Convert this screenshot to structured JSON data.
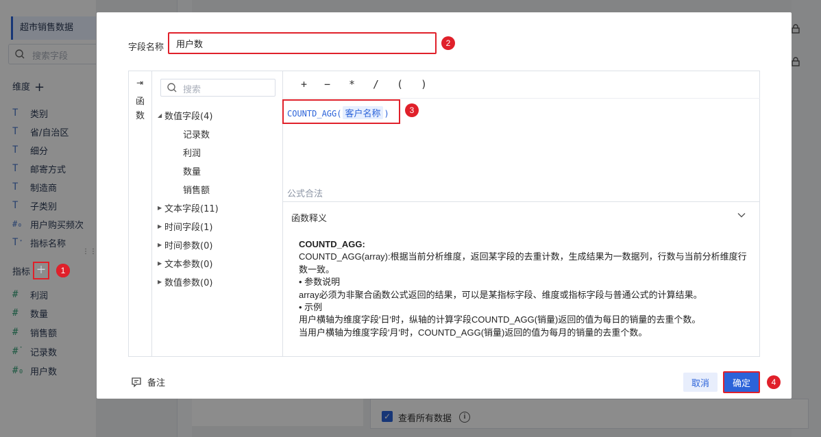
{
  "sidebar": {
    "dataset": "超市销售数据",
    "search_placeholder": "搜索字段",
    "dimension_header": "维度",
    "dimensions": [
      {
        "icon": "text-field-icon",
        "label": "类别"
      },
      {
        "icon": "text-field-icon",
        "label": "省/自治区"
      },
      {
        "icon": "text-field-icon",
        "label": "细分"
      },
      {
        "icon": "text-field-icon",
        "label": "邮寄方式"
      },
      {
        "icon": "text-field-icon",
        "label": "制造商"
      },
      {
        "icon": "text-field-icon",
        "label": "子类别"
      },
      {
        "icon": "numeric-dimension-icon",
        "label": "用户购买频次"
      },
      {
        "icon": "text-field-icon",
        "label": "指标名称"
      }
    ],
    "measure_header": "指标",
    "measures": [
      {
        "icon": "number-field-icon",
        "label": "利润"
      },
      {
        "icon": "number-field-icon",
        "label": "数量"
      },
      {
        "icon": "number-field-icon",
        "label": "销售额"
      },
      {
        "icon": "calc-field-icon",
        "label": "记录数"
      },
      {
        "icon": "calc-field-icon",
        "label": "用户数"
      }
    ]
  },
  "badges": {
    "b1": "1",
    "b2": "2",
    "b3": "3",
    "b4": "4"
  },
  "background": {
    "view_all_label": "查看所有数据",
    "view_all_checked": true
  },
  "modal": {
    "field_name_label": "字段名称",
    "field_name_value": "用户数",
    "function_tab": "函数",
    "tree_search_placeholder": "搜索",
    "tree": [
      {
        "label": "数值字段(4)",
        "expanded": true,
        "children": [
          "记录数",
          "利润",
          "数量",
          "销售额"
        ]
      },
      {
        "label": "文本字段(11)",
        "expanded": false
      },
      {
        "label": "时间字段(1)",
        "expanded": false
      },
      {
        "label": "时间参数(0)",
        "expanded": false
      },
      {
        "label": "文本参数(0)",
        "expanded": false
      },
      {
        "label": "数值参数(0)",
        "expanded": false
      }
    ],
    "operators": [
      "+",
      "−",
      "*",
      "/",
      "(",
      ")"
    ],
    "formula": {
      "function": "COUNTD_AGG",
      "open": "(",
      "token": "客户名称",
      "close": ")"
    },
    "validation": "公式合法",
    "explain_header": "函数释义",
    "explain": {
      "title": "COUNTD_AGG:",
      "line1": "COUNTD_AGG(array):根据当前分析维度，返回某字段的去重计数，生成结果为一数据列，行数与当前分析维度行数一致。",
      "line2": "• 参数说明",
      "line3": "array必须为非聚合函数公式返回的结果，可以是某指标字段、维度或指标字段与普通公式的计算结果。",
      "line4": "• 示例",
      "line5": "用户横轴为维度字段'日'时，纵轴的计算字段COUNTD_AGG(销量)返回的值为每日的销量的去重个数。",
      "line6": "当用户横轴为维度字段'月'时，COUNTD_AGG(销量)返回的值为每月的销量的去重个数。"
    },
    "note_label": "备注",
    "cancel_label": "取消",
    "ok_label": "确定"
  },
  "colors": {
    "accent": "#2b63d9",
    "highlight": "#e0202a"
  }
}
